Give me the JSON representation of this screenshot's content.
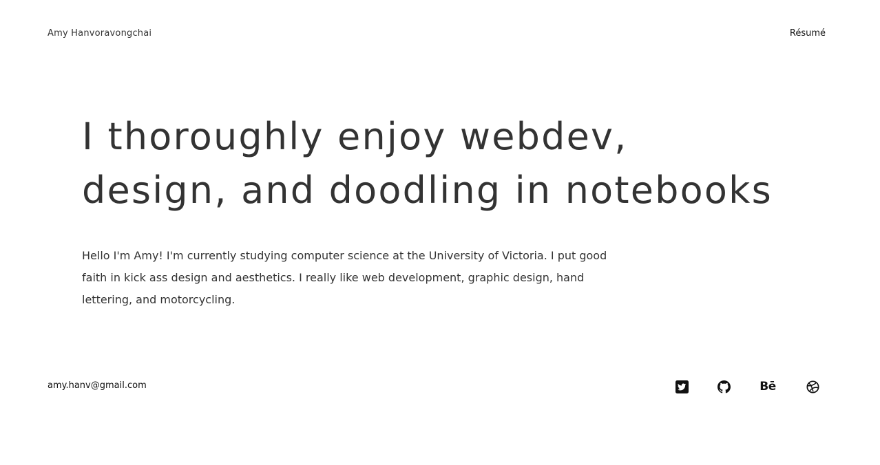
{
  "header": {
    "name": "Amy Hanvoravongchai",
    "resume_label": "Résumé"
  },
  "hero": {
    "title_line1": "I thoroughly enjoy webdev,",
    "title_line2": "design, and doodling in notebooks",
    "bio": "Hello I'm Amy! I'm currently studying computer science at the University of Victoria. I put good faith in kick ass design and aesthetics. I really like web development, graphic design, hand lettering, and motorcycling."
  },
  "footer": {
    "email": "amy.hanv@gmail.com",
    "social_links": [
      {
        "icon": "twitter-icon"
      },
      {
        "icon": "github-icon"
      },
      {
        "icon": "behance-icon",
        "glyph": "Bē"
      },
      {
        "icon": "dribbble-icon"
      }
    ]
  },
  "colors": {
    "text": "#333333",
    "background": "#ffffff",
    "icon": "#111111"
  }
}
